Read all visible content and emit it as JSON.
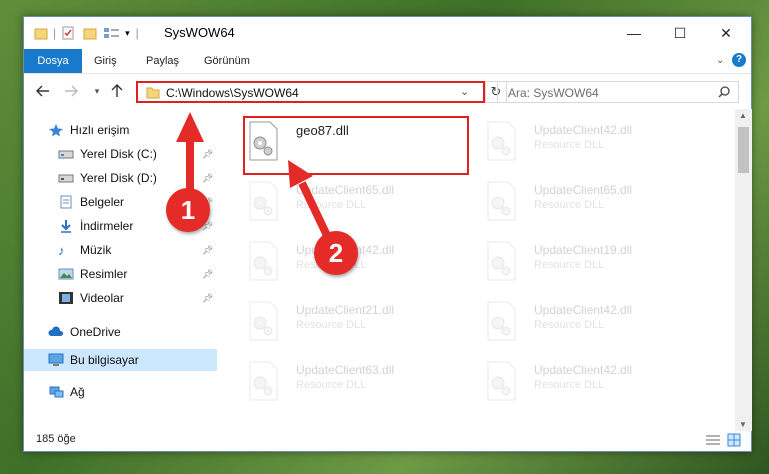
{
  "window": {
    "title": "SysWOW64",
    "controls": {
      "minimize": "—",
      "maximize": "☐",
      "close": "✕"
    }
  },
  "ribbon": {
    "tabs": [
      {
        "label": "Dosya"
      },
      {
        "label": "Giriş"
      },
      {
        "label": "Paylaş"
      },
      {
        "label": "Görünüm"
      }
    ],
    "expand_icon": "chevron-down-icon",
    "help_icon": "help-icon"
  },
  "navigation": {
    "address": "C:\\Windows\\SysWOW64",
    "search_placeholder": "Ara: SysWOW64"
  },
  "sidebar": {
    "items": [
      {
        "label": "Hızlı erişim",
        "icon": "star-icon"
      },
      {
        "label": "Yerel Disk (C:)",
        "icon": "drive-icon",
        "pinned": true
      },
      {
        "label": "Yerel Disk (D:)",
        "icon": "drive-icon",
        "pinned": true
      },
      {
        "label": "Belgeler",
        "icon": "documents-icon",
        "pinned": true
      },
      {
        "label": "İndirmeler",
        "icon": "download-icon",
        "pinned": true
      },
      {
        "label": "Müzik",
        "icon": "music-icon",
        "pinned": true
      },
      {
        "label": "Resimler",
        "icon": "pictures-icon",
        "pinned": true
      },
      {
        "label": "Videolar",
        "icon": "videos-icon",
        "pinned": true
      },
      {
        "label": "OneDrive",
        "icon": "cloud-icon"
      },
      {
        "label": "Bu bilgisayar",
        "icon": "computer-icon",
        "selected": true
      },
      {
        "label": "Ağ",
        "icon": "network-icon"
      }
    ]
  },
  "files": {
    "col1": [
      {
        "name": "geo87.dll",
        "type": ""
      },
      {
        "name": "UpdateClient65.dll",
        "type": "Resource DLL"
      },
      {
        "name": "UpdateClient42.dll",
        "type": "Resource DLL"
      },
      {
        "name": "UpdateClient21.dll",
        "type": "Resource DLL"
      },
      {
        "name": "UpdateClient63.dll",
        "type": "Resource DLL"
      }
    ],
    "col2": [
      {
        "name": "UpdateClient42.dll",
        "type": "Resource DLL"
      },
      {
        "name": "UpdateClient65.dll",
        "type": "Resource DLL"
      },
      {
        "name": "UpdateClient19.dll",
        "type": "Resource DLL"
      },
      {
        "name": "UpdateClient42.dll",
        "type": "Resource DLL"
      },
      {
        "name": "UpdateClient42.dll",
        "type": "Resource DLL"
      }
    ]
  },
  "status": {
    "item_count": "185 öğe"
  },
  "annotations": {
    "marker1": "1",
    "marker2": "2",
    "color": "#e42b27"
  }
}
